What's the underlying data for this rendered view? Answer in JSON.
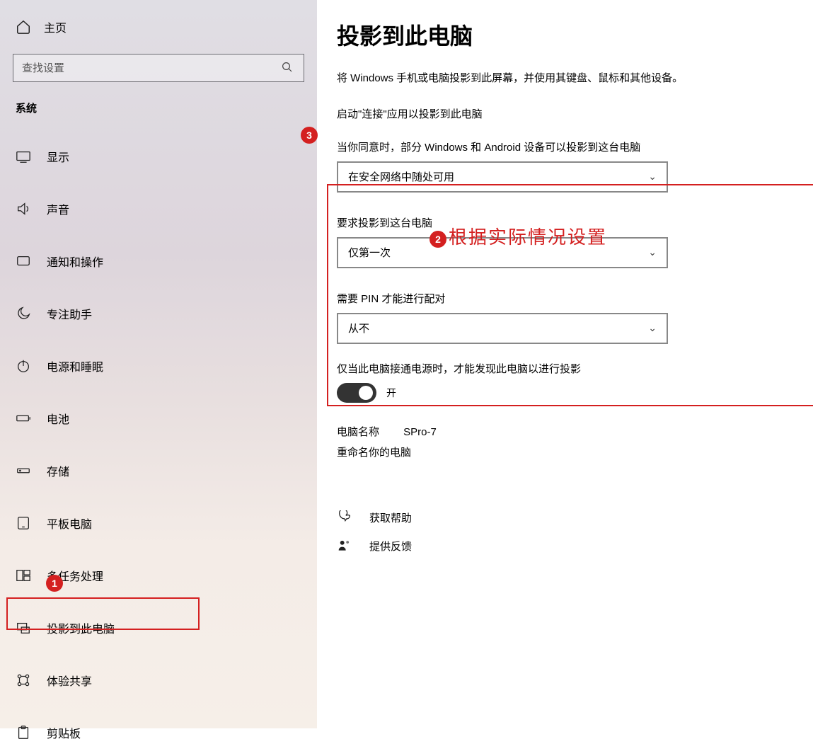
{
  "sidebar": {
    "home_label": "主页",
    "search_placeholder": "查找设置",
    "category": "系统",
    "items": [
      {
        "label": "显示"
      },
      {
        "label": "声音"
      },
      {
        "label": "通知和操作"
      },
      {
        "label": "专注助手"
      },
      {
        "label": "电源和睡眠"
      },
      {
        "label": "电池"
      },
      {
        "label": "存储"
      },
      {
        "label": "平板电脑"
      },
      {
        "label": "多任务处理"
      },
      {
        "label": "投影到此电脑"
      },
      {
        "label": "体验共享"
      },
      {
        "label": "剪贴板"
      }
    ]
  },
  "main": {
    "title": "投影到此电脑",
    "desc": "将 Windows 手机或电脑投影到此屏幕，并使用其键盘、鼠标和其他设备。",
    "connect_app": "启动\"连接\"应用以投影到此电脑",
    "s1_label": "当你同意时，部分 Windows 和 Android 设备可以投影到这台电脑",
    "s1_value": "在安全网络中随处可用",
    "s2_label": "要求投影到这台电脑",
    "s2_value": "仅第一次",
    "s3_label": "需要 PIN 才能进行配对",
    "s3_value": "从不",
    "power_label": "仅当此电脑接通电源时，才能发现此电脑以进行投影",
    "toggle_state": "开",
    "pcname_label": "电脑名称",
    "pcname_value": "SPro-7",
    "rename": "重命名你的电脑",
    "help": "获取帮助",
    "feedback": "提供反馈"
  },
  "annot": {
    "b1": "1",
    "b2": "2",
    "b3": "3",
    "text": "根据实际情况设置"
  }
}
